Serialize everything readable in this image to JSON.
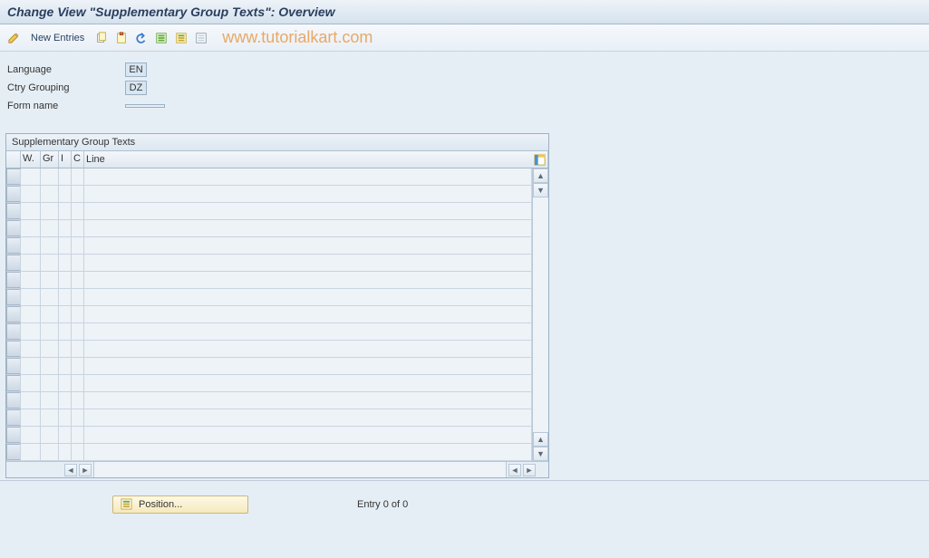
{
  "header": {
    "title": "Change View \"Supplementary Group Texts\": Overview"
  },
  "toolbar": {
    "new_entries_label": "New Entries",
    "icons": [
      {
        "name": "glasses-icon"
      },
      {
        "name": "copy-icon"
      },
      {
        "name": "clipboard-icon"
      },
      {
        "name": "undo-icon"
      },
      {
        "name": "select-all-icon"
      },
      {
        "name": "select-block-icon"
      },
      {
        "name": "deselect-icon"
      }
    ]
  },
  "watermark": "www.tutorialkart.com",
  "form": {
    "rows": [
      {
        "label": "Language",
        "value": "EN"
      },
      {
        "label": "Ctry Grouping",
        "value": "DZ"
      },
      {
        "label": "Form name",
        "value": ""
      }
    ]
  },
  "table": {
    "title": "Supplementary Group Texts",
    "columns": [
      {
        "key": "sel",
        "label": ""
      },
      {
        "key": "w",
        "label": "W."
      },
      {
        "key": "gr",
        "label": "Gr"
      },
      {
        "key": "i",
        "label": "I"
      },
      {
        "key": "c",
        "label": "C"
      },
      {
        "key": "line",
        "label": "Line"
      }
    ],
    "row_count": 17
  },
  "footer": {
    "position_label": "Position...",
    "entry_text": "Entry 0 of 0"
  }
}
